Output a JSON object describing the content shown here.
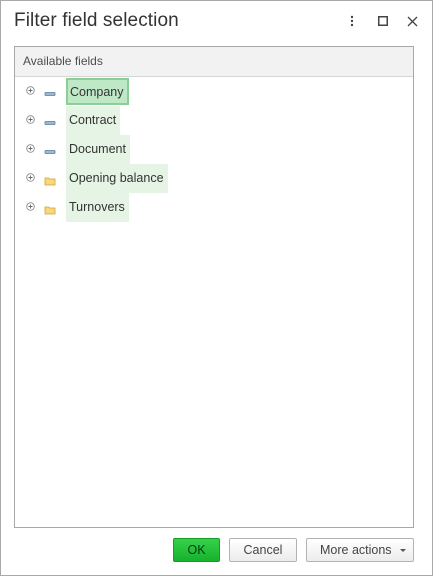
{
  "window": {
    "title": "Filter field selection"
  },
  "panel": {
    "header": "Available fields",
    "items": [
      {
        "label": "Company",
        "icon": "field-icon",
        "selected": true
      },
      {
        "label": "Contract",
        "icon": "field-icon",
        "selected": false
      },
      {
        "label": "Document",
        "icon": "field-icon",
        "selected": false
      },
      {
        "label": "Opening balance",
        "icon": "folder-icon",
        "selected": false
      },
      {
        "label": "Turnovers",
        "icon": "folder-icon",
        "selected": false
      }
    ]
  },
  "buttons": {
    "ok": "OK",
    "cancel": "Cancel",
    "more_actions": "More actions"
  },
  "colors": {
    "accent_green": "#17b22d",
    "selection_bg": "#bfe8c6",
    "item_bg": "#e5f4e5",
    "field_icon": "#5a7da0",
    "folder_icon": "#e8b84a"
  }
}
